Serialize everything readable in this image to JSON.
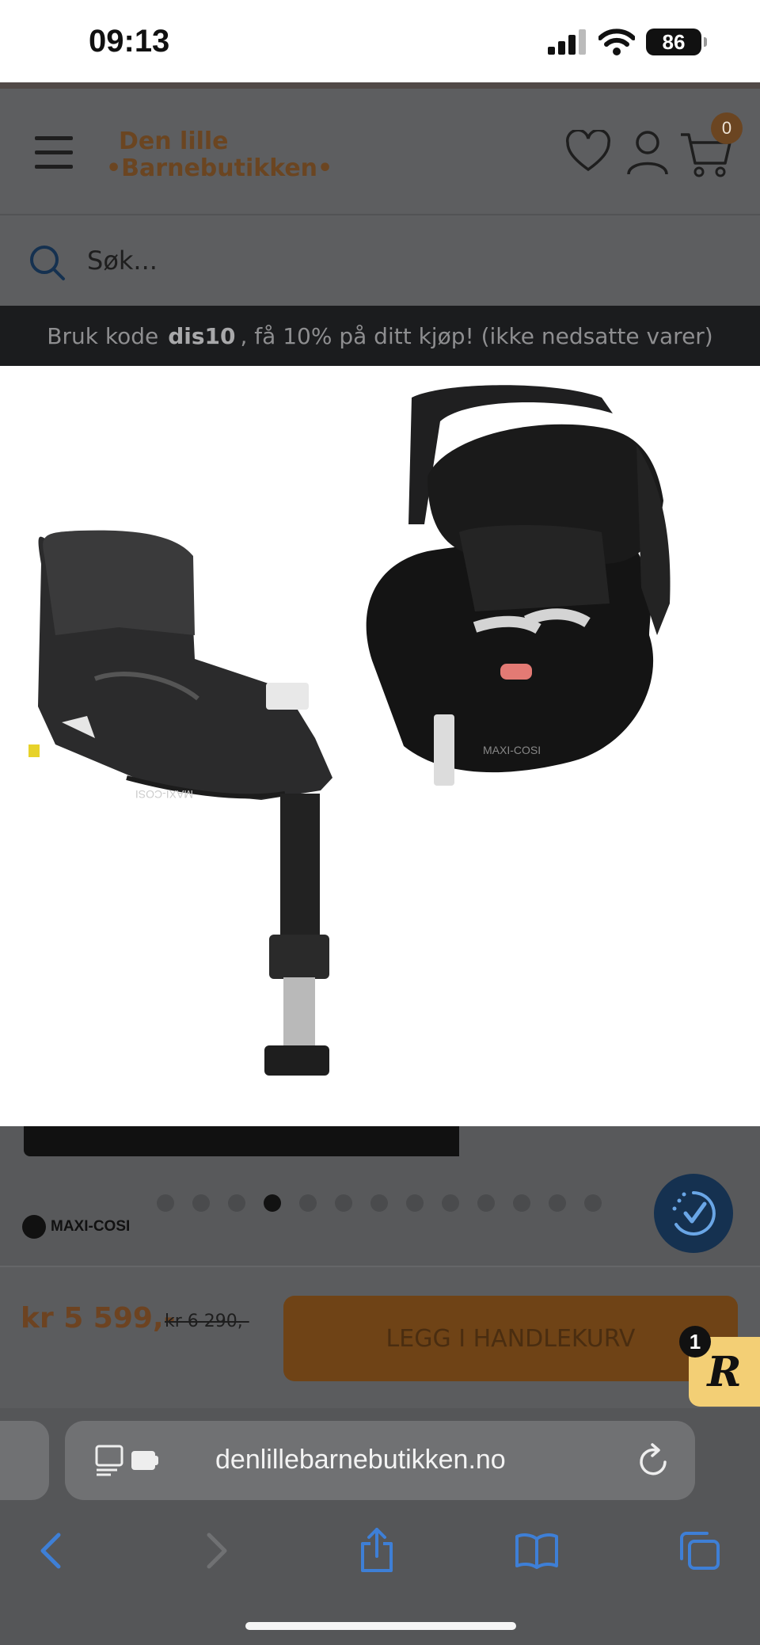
{
  "status_bar": {
    "time": "09:13",
    "battery": "86"
  },
  "header": {
    "logo_line1": "Den lille",
    "logo_line2": "•Barnebutikken•",
    "cart_count": "0"
  },
  "search": {
    "placeholder": "Søk..."
  },
  "promo": {
    "prefix": "Bruk kode",
    "code": "dis10",
    "suffix": ", få 10% på ditt kjøp! (ikke nedsatte varer)"
  },
  "gallery": {
    "dot_count": 13,
    "active_index": 3,
    "brand": "MAXI-COSI"
  },
  "product": {
    "price": "kr 5 599,-",
    "old_price": "kr 6 290,-",
    "add_to_cart_label": "LEGG I HANDLEKURV"
  },
  "rewards": {
    "badge": "1",
    "letter": "R"
  },
  "browser": {
    "url": "denlillebarnebutikken.no"
  },
  "colors": {
    "brand_brown": "#6b4521",
    "safari_blue": "#3e7fd6",
    "accessibility_navy": "#153150",
    "rewards_yellow": "#f3cf75"
  }
}
